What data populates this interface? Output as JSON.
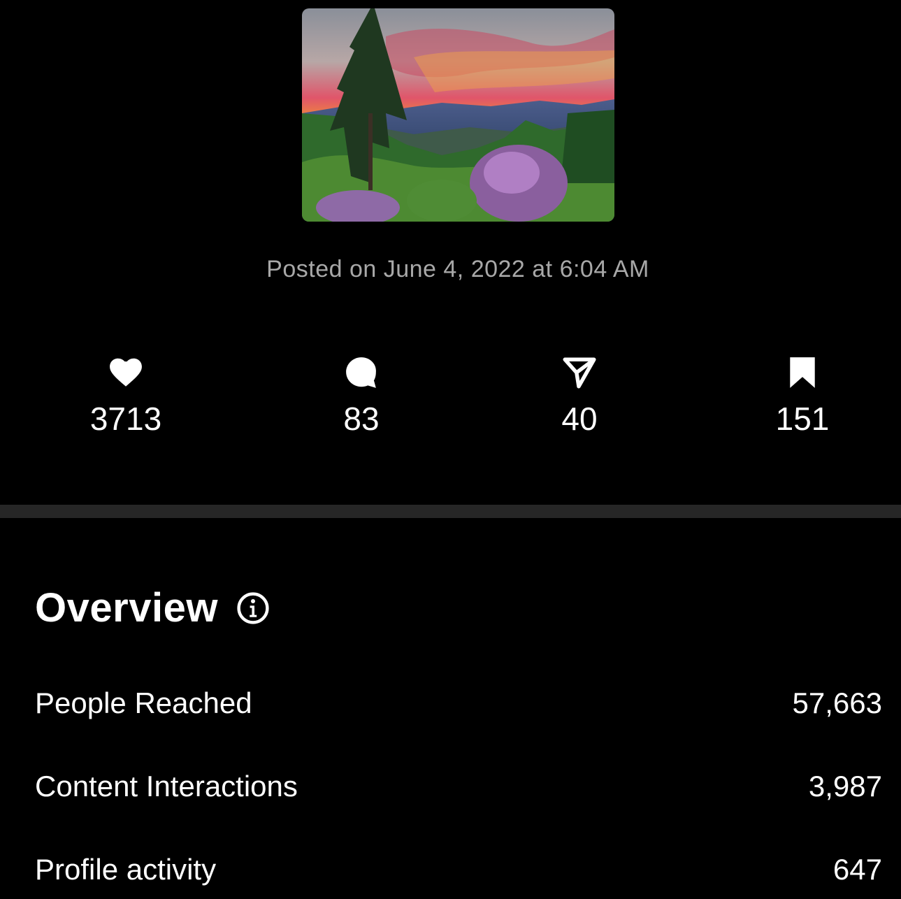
{
  "post": {
    "image_alt": "Mountain sunset landscape",
    "posted_on": "Posted on June 4, 2022 at 6:04 AM"
  },
  "stats": {
    "likes": {
      "icon": "heart-icon",
      "count": "3713"
    },
    "comments": {
      "icon": "comment-icon",
      "count": "83"
    },
    "shares": {
      "icon": "share-icon",
      "count": "40"
    },
    "saves": {
      "icon": "bookmark-icon",
      "count": "151"
    }
  },
  "overview": {
    "title": "Overview",
    "info_icon": "info-icon",
    "rows": [
      {
        "label": "People Reached",
        "value": "57,663"
      },
      {
        "label": "Content Interactions",
        "value": "3,987"
      },
      {
        "label": "Profile activity",
        "value": "647"
      }
    ]
  },
  "colors": {
    "background": "#000000",
    "text": "#ffffff",
    "muted_text": "#a8a8a8",
    "divider": "#262626"
  }
}
